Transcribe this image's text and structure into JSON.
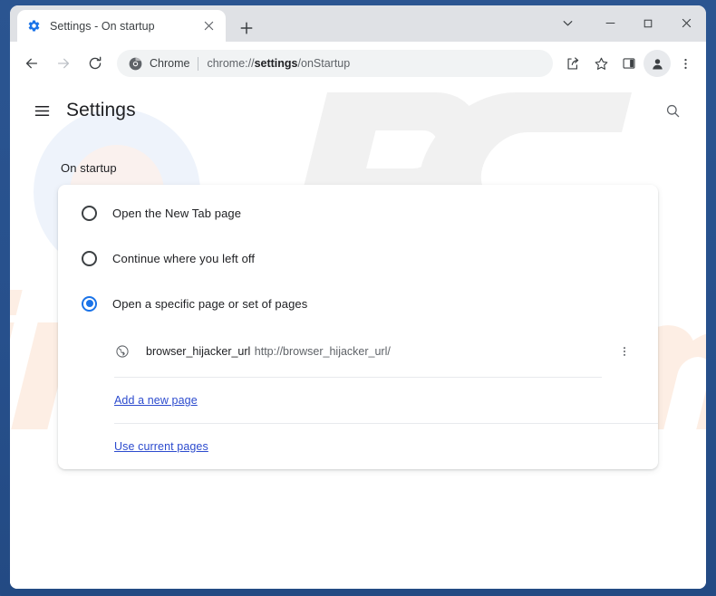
{
  "window": {
    "frame_color": "#27508c",
    "controls": [
      {
        "name": "tab-search",
        "glyph": "tab-search-chevron-icon"
      },
      {
        "name": "minimize",
        "glyph": "minimize-icon"
      },
      {
        "name": "maximize",
        "glyph": "maximize-icon"
      },
      {
        "name": "close",
        "glyph": "close-icon"
      }
    ]
  },
  "tabstrip": {
    "active_tab": {
      "title": "Settings - On startup",
      "favicon": "settings-gear-icon",
      "close_glyph": "close-icon"
    },
    "new_tab_label": "+",
    "new_tab_tooltip": "New tab"
  },
  "toolbar": {
    "back": "back-arrow-icon",
    "forward": "forward-arrow-icon",
    "reload": "reload-icon",
    "omnibox": {
      "chrome_icon": "chrome-logo-icon",
      "scheme_label": "Chrome",
      "url_prefix": "chrome://",
      "url_bold": "settings",
      "url_suffix": "/onStartup",
      "full_url": "chrome://settings/onStartup"
    },
    "actions": [
      {
        "name": "share",
        "glyph": "share-icon"
      },
      {
        "name": "bookmark",
        "glyph": "star-icon"
      },
      {
        "name": "side-panel",
        "glyph": "side-panel-icon"
      },
      {
        "name": "profile",
        "glyph": "avatar-icon"
      },
      {
        "name": "chrome-menu",
        "glyph": "three-dot-vertical-icon"
      }
    ]
  },
  "settings": {
    "menu_icon": "hamburger-menu-icon",
    "title": "Settings",
    "search_icon": "search-icon",
    "section_title": "On startup",
    "radio_group": {
      "options": [
        {
          "label": "Open the New Tab page",
          "selected": false
        },
        {
          "label": "Continue where you left off",
          "selected": false
        },
        {
          "label": "Open a specific page or set of pages",
          "selected": true
        }
      ]
    },
    "startup_pages": [
      {
        "favicon": "globe-icon",
        "name": "browser_hijacker_url",
        "url": "http://browser_hijacker_url/",
        "menu_glyph": "three-dot-vertical-icon"
      }
    ],
    "links": [
      {
        "label": "Add a new page"
      },
      {
        "label": "Use current pages"
      }
    ]
  },
  "watermark": {
    "primary_text": "PC",
    "secondary_text": "risk.com",
    "primary_color": "#f0f0f0",
    "secondary_color": "#fdeee4",
    "lens_color": "#eef2fa"
  },
  "colors": {
    "accent_blue": "#1a73e8",
    "link_blue": "#2c4bce",
    "text_primary": "#202124",
    "text_secondary": "#5f6368",
    "tabstrip_bg": "#dfe1e5",
    "omnibox_bg": "#f1f3f4"
  }
}
